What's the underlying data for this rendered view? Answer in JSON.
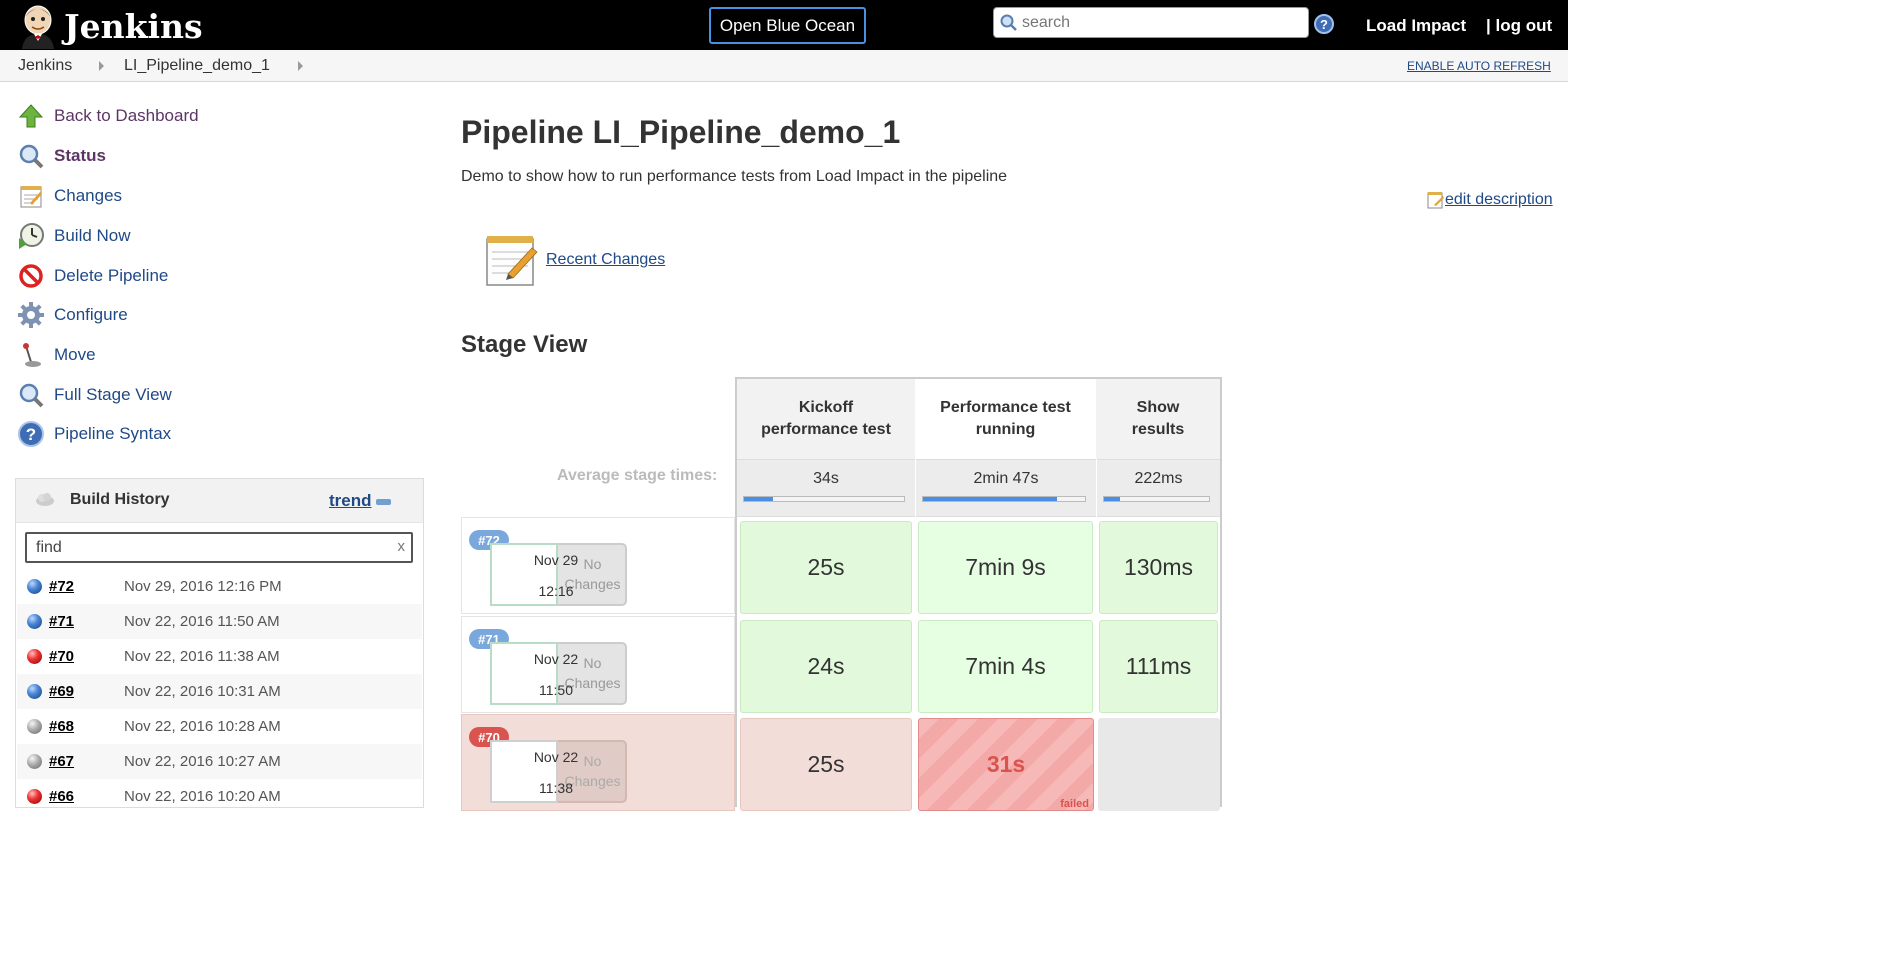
{
  "header": {
    "app_name": "Jenkins",
    "blue_ocean": "Open Blue Ocean",
    "search_placeholder": "search",
    "help": "?",
    "user": "Load Impact",
    "logout": "| log out"
  },
  "breadcrumb": {
    "items": [
      "Jenkins",
      "LI_Pipeline_demo_1"
    ],
    "auto_refresh": "ENABLE AUTO REFRESH"
  },
  "sidebar": {
    "tasks": [
      {
        "label": "Back to Dashboard",
        "icon": "up-arrow-icon"
      },
      {
        "label": "Status",
        "icon": "magnifier-icon"
      },
      {
        "label": "Changes",
        "icon": "notepad-icon"
      },
      {
        "label": "Build Now",
        "icon": "clock-icon"
      },
      {
        "label": "Delete Pipeline",
        "icon": "no-entry-icon"
      },
      {
        "label": "Configure",
        "icon": "gear-icon"
      },
      {
        "label": "Move",
        "icon": "joystick-icon"
      },
      {
        "label": "Full Stage View",
        "icon": "magnifier-icon"
      },
      {
        "label": "Pipeline Syntax",
        "icon": "help-icon"
      }
    ]
  },
  "build_history": {
    "title": "Build History",
    "trend": "trend",
    "find_placeholder": "find",
    "clear": "x",
    "builds": [
      {
        "num": "#72",
        "date": "Nov 29, 2016 12:16 PM",
        "status": "blue"
      },
      {
        "num": "#71",
        "date": "Nov 22, 2016 11:50 AM",
        "status": "blue"
      },
      {
        "num": "#70",
        "date": "Nov 22, 2016 11:38 AM",
        "status": "red"
      },
      {
        "num": "#69",
        "date": "Nov 22, 2016 10:31 AM",
        "status": "blue"
      },
      {
        "num": "#68",
        "date": "Nov 22, 2016 10:28 AM",
        "status": "grey"
      },
      {
        "num": "#67",
        "date": "Nov 22, 2016 10:27 AM",
        "status": "grey"
      },
      {
        "num": "#66",
        "date": "Nov 22, 2016 10:20 AM",
        "status": "red"
      }
    ]
  },
  "main": {
    "title": "Pipeline LI_Pipeline_demo_1",
    "description": "Demo to show how to run performance tests from Load Impact in the pipeline",
    "edit_description": "edit description",
    "recent_changes": "Recent Changes",
    "stage_view_title": "Stage View"
  },
  "stage_view": {
    "avg_label": "Average stage times:",
    "stages": [
      {
        "line1": "Kickoff",
        "line2": "performance test",
        "avg": "34s",
        "avg_fraction": 0.18
      },
      {
        "line1": "Performance test",
        "line2": "running",
        "avg": "2min 47s",
        "avg_fraction": 0.83
      },
      {
        "line1": "Show",
        "line2": "results",
        "avg": "222ms",
        "avg_fraction": 0.15
      }
    ],
    "builds": [
      {
        "badge": "#72",
        "date": "Nov 29",
        "time": "12:16",
        "changes1": "No",
        "changes2": "Changes",
        "status": "success",
        "cells": [
          "25s",
          "7min 9s",
          "130ms"
        ]
      },
      {
        "badge": "#71",
        "date": "Nov 22",
        "time": "11:50",
        "changes1": "No",
        "changes2": "Changes",
        "status": "success",
        "cells": [
          "24s",
          "7min 4s",
          "111ms"
        ]
      },
      {
        "badge": "#70",
        "date": "Nov 22",
        "time": "11:38",
        "changes1": "No",
        "changes2": "Changes",
        "status": "failed",
        "cells": [
          "25s",
          "31s",
          ""
        ],
        "failed_label": "failed"
      }
    ]
  },
  "colors": {
    "header_bg": "#000000",
    "link": "#204a87",
    "success_cell": "#e6ffe2",
    "failed_cell": "#f7b8b8",
    "accent_blue": "#4a90e2"
  }
}
